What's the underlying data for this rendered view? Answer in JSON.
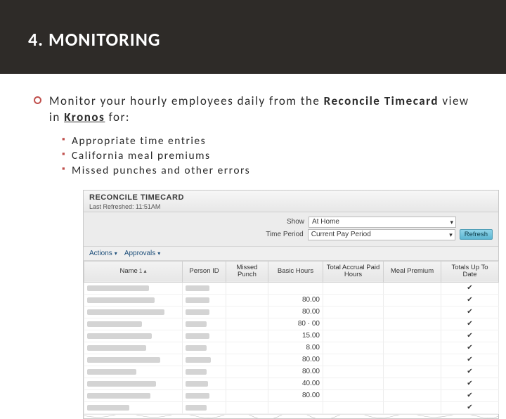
{
  "title": "4. MONITORING",
  "lead": {
    "p1": "Monitor your hourly employees daily from the ",
    "bold1": "Reconcile Timecard",
    "p2": " view in ",
    "ul1": "Kronos",
    "p3": " for:"
  },
  "subs": {
    "a": "Appropriate time entries",
    "b": "California meal premiums",
    "c": "Missed punches and other errors"
  },
  "shot": {
    "title": "RECONCILE TIMECARD",
    "refreshed": "Last Refreshed: 11:51AM",
    "filters": {
      "show_lbl": "Show",
      "show_val": "At Home",
      "period_lbl": "Time Period",
      "period_val": "Current Pay Period",
      "refresh": "Refresh"
    },
    "toolbar": {
      "actions": "Actions",
      "approvals": "Approvals"
    },
    "cols": {
      "name": "Name",
      "sort": "1 ▴",
      "pid": "Person ID",
      "missed": "Missed Punch",
      "basic": "Basic Hours",
      "accrual": "Total Accrual Paid Hours",
      "meal": "Meal Premium",
      "totals": "Totals Up To Date"
    },
    "rows": [
      {
        "basic": "",
        "chk": "✔"
      },
      {
        "basic": "80.00",
        "chk": "✔"
      },
      {
        "basic": "80.00",
        "chk": "✔"
      },
      {
        "basic": "80 · 00",
        "chk": "✔"
      },
      {
        "basic": "15.00",
        "chk": "✔"
      },
      {
        "basic": "8.00",
        "chk": "✔"
      },
      {
        "basic": "80.00",
        "chk": "✔"
      },
      {
        "basic": "80.00",
        "chk": "✔"
      },
      {
        "basic": "40.00",
        "chk": "✔"
      },
      {
        "basic": "80.00",
        "chk": "✔"
      },
      {
        "basic": "",
        "chk": "✔"
      }
    ],
    "blur_name_w": [
      "88px",
      "96px",
      "110px",
      "78px",
      "92px",
      "84px",
      "104px",
      "70px",
      "98px",
      "90px",
      "60px"
    ],
    "blur_pid_w": [
      "34px",
      "34px",
      "34px",
      "30px",
      "34px",
      "30px",
      "36px",
      "30px",
      "32px",
      "34px",
      "30px"
    ]
  }
}
